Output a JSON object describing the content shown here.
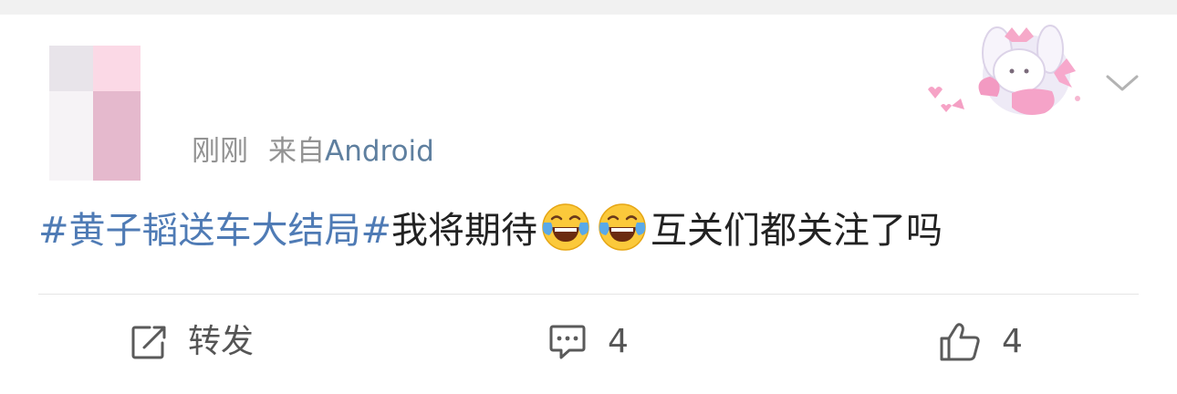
{
  "post": {
    "time": "刚刚",
    "source_prefix": "来自",
    "source": "Android",
    "topic": "#黄子韬送车大结局#",
    "text_before_emoji": "我将期待",
    "emojis": [
      "laughing-tears-emoji",
      "laughing-tears-emoji"
    ],
    "text_after_emoji": "互关们都关注了吗"
  },
  "actions": {
    "repost_label": "转发",
    "comment_count": "4",
    "like_count": "4"
  },
  "colors": {
    "topic": "#4f7bb5",
    "source": "#5e7f9f",
    "meta_gray": "#939393",
    "body_text": "#222222",
    "action_gray": "#555555"
  }
}
